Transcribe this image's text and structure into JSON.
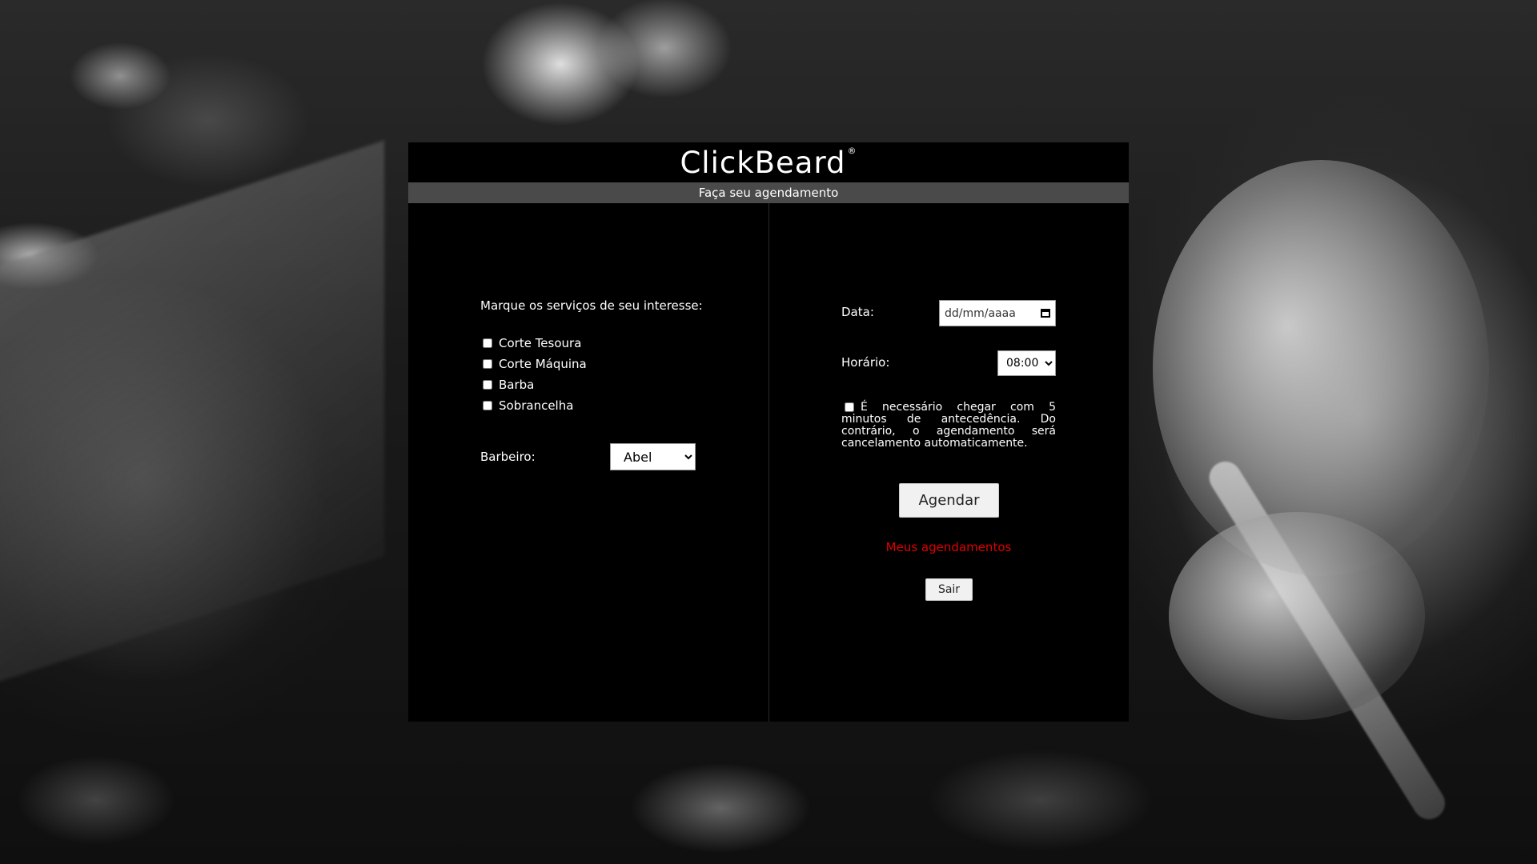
{
  "app": {
    "title": "ClickBeard",
    "trademark": "®",
    "subtitle": "Faça seu agendamento"
  },
  "services": {
    "prompt": "Marque os serviços de seu interesse:",
    "options": [
      {
        "label": "Corte Tesoura",
        "checked": false
      },
      {
        "label": "Corte Máquina",
        "checked": false
      },
      {
        "label": "Barba",
        "checked": false
      },
      {
        "label": "Sobrancelha",
        "checked": false
      }
    ]
  },
  "barber": {
    "label": "Barbeiro:",
    "selected": "Abel"
  },
  "date": {
    "label": "Data:",
    "placeholder": "dd/mm/aaaa"
  },
  "time": {
    "label": "Horário:",
    "selected": "08:00"
  },
  "notice": {
    "checked": false,
    "text": "É necessário chegar com 5 minutos de antecedência. Do contrário, o agendamento será cancelamento automaticamente."
  },
  "actions": {
    "schedule_label": "Agendar",
    "my_appointments_label": "Meus agendamentos",
    "logout_label": "Sair"
  },
  "colors": {
    "card_background": "#000000",
    "subtitle_bar": "#4a4a4a",
    "link": "#e00000",
    "button_background": "#f1f1f1"
  }
}
